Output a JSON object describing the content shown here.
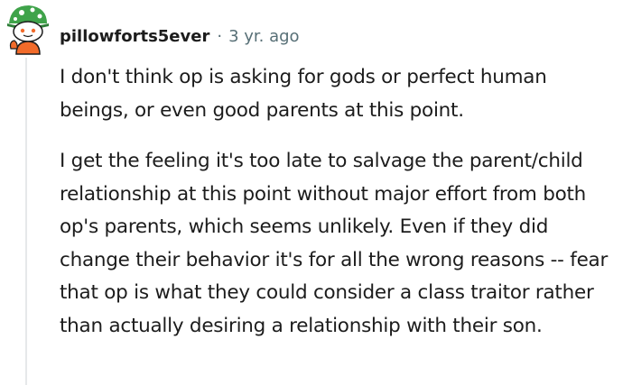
{
  "comment": {
    "avatar_icon": "snoo-avatar-icon",
    "author": "pillowforts5ever",
    "separator": "·",
    "age": "3 yr. ago",
    "paragraphs": [
      "I don't think op is asking for gods or perfect human beings, or even good parents at this point.",
      "I get the feeling it's too late to salvage the parent/child relationship at this point without major effort from both op's parents, which seems unlikely. Even if they did change their behavior it's for all the wrong reasons -- fear that op is what they could consider a class traitor rather than actually desiring a relationship with their son."
    ]
  },
  "colors": {
    "text": "#1c1c1c",
    "meta": "#576f76",
    "thread_line": "#e6e8ea",
    "avatar_green": "#3fa34a",
    "avatar_orange": "#f26b2a"
  }
}
